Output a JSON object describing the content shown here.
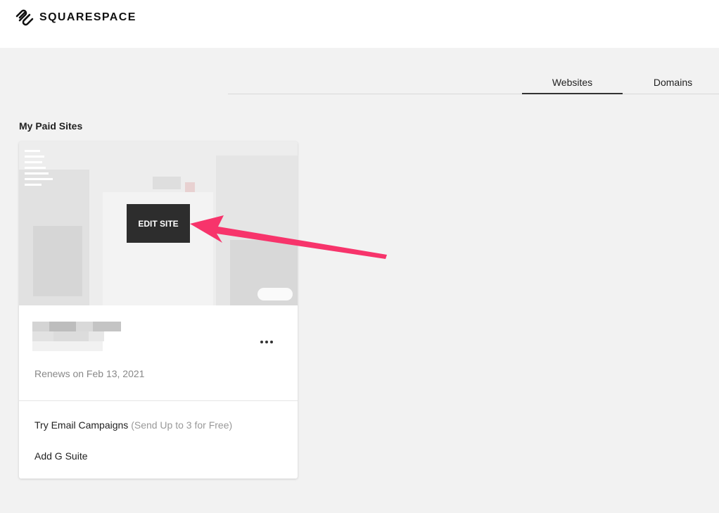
{
  "header": {
    "logo_text": "SQUARESPACE",
    "logo_icon": "squarespace-logo-icon"
  },
  "tabs": [
    {
      "label": "Websites",
      "active": true
    },
    {
      "label": "Domains",
      "active": false
    }
  ],
  "section": {
    "title": "My Paid Sites"
  },
  "site_card": {
    "edit_button": "EDIT SITE",
    "renews": "Renews on Feb 13, 2021",
    "more_icon": "more-dots-icon",
    "links": {
      "email": "Try Email Campaigns",
      "email_note": "(Send Up to 3 for Free)",
      "gsuite": "Add G Suite"
    }
  },
  "colors": {
    "arrow": "#f7346b",
    "edit_button_bg": "#2d2d2d",
    "page_bg": "#f2f2f2"
  }
}
